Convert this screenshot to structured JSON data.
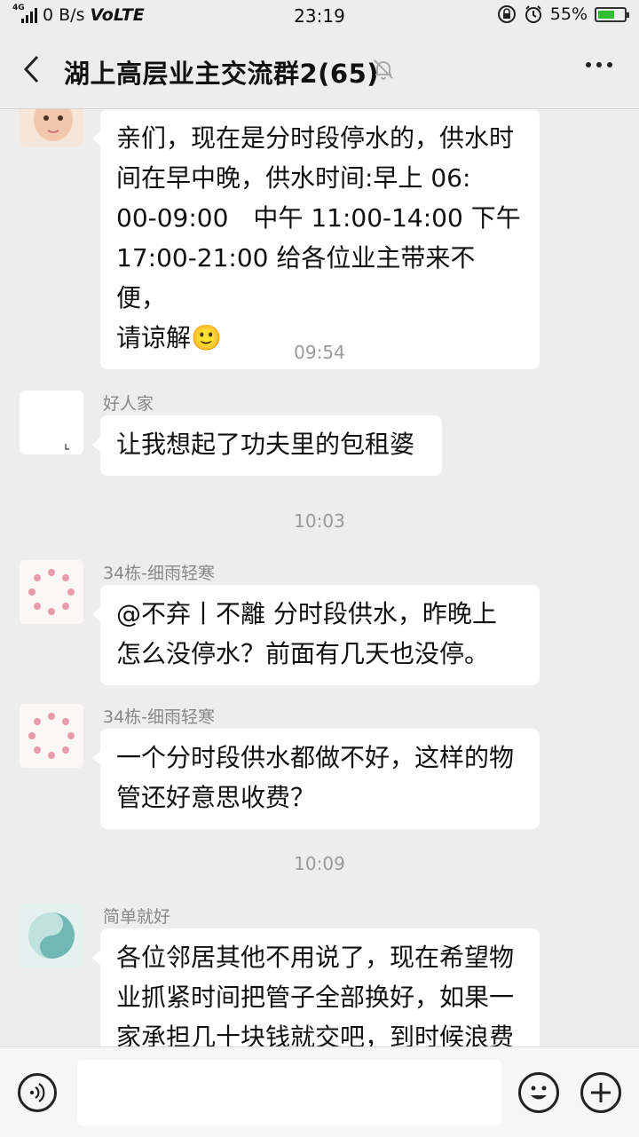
{
  "status_bar": {
    "network": "4G",
    "speed": "0 B/s",
    "volte": "VoLTE",
    "time": "23:19",
    "battery": "55%"
  },
  "header": {
    "title": "湖上高层业主交流群2(65)"
  },
  "messages": [
    {
      "sender": "",
      "lines": [
        "亲们，现在是分时段停水的，供水时",
        "间在早中晚，供水时间:早上 06:",
        "00-09:00　中午 11:00-14:00 下午",
        "17:00-21:00 给各位业主带来不便，",
        "请谅解🙂"
      ]
    },
    {
      "timestamp": "09:54",
      "sender": "好人家",
      "lines": [
        "让我想起了功夫里的包租婆"
      ]
    },
    {
      "timestamp": "10:03",
      "sender": "34栋-细雨轻寒",
      "lines": [
        "@不弃丨不離 分时段供水，昨晚上",
        "怎么没停水？前面有几天也没停。"
      ]
    },
    {
      "sender": "34栋-细雨轻寒",
      "lines": [
        "一个分时段供水都做不好，这样的物",
        "管还好意思收费？"
      ]
    },
    {
      "timestamp": "10:09",
      "sender": "简单就好",
      "lines": [
        "各位邻居其他不用说了，现在希望物",
        "业抓紧时间把管子全部换好，如果一",
        "家承担几十块钱就交吧，到时候浪费"
      ]
    }
  ],
  "avatar_icons": {
    "m0": "baby-photo-icon",
    "m1": "blank-avatar-icon",
    "m2": "cherry-blossom-wreath-icon",
    "m3": "cherry-blossom-wreath-icon",
    "m4": "yin-yang-avatar-icon"
  },
  "colors": {
    "chat_bg": "#ededed",
    "bubble": "#ffffff",
    "battery_fill": "#2fbf2f"
  }
}
